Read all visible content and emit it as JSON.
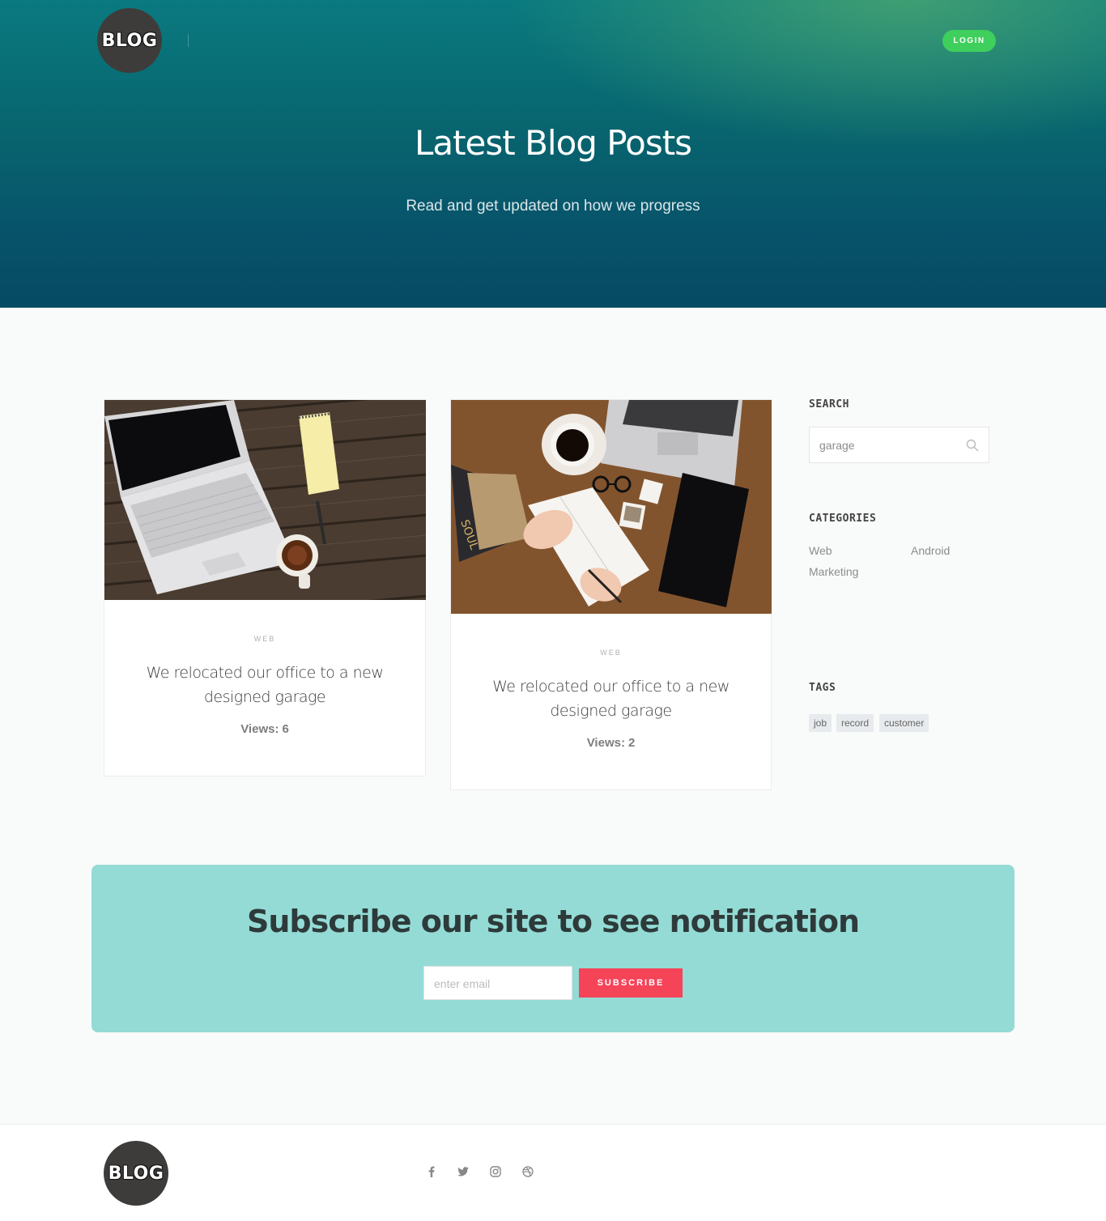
{
  "header": {
    "logo_text": "BLOG",
    "login_label": "LOGIN",
    "title": "Latest Blog Posts",
    "subtitle": "Read and get updated on how we progress"
  },
  "posts": [
    {
      "category": "WEB",
      "title": "We relocated our office to a new designed garage",
      "views_label": "Views:",
      "views": "6"
    },
    {
      "category": "WEB",
      "title": "We relocated our office to a new designed garage",
      "views_label": "Views:",
      "views": "2"
    }
  ],
  "sidebar": {
    "search_heading": "SEARCH",
    "search_value": "garage",
    "categories_heading": "CATEGORIES",
    "categories": [
      "Web",
      "Android",
      "Marketing"
    ],
    "tags_heading": "TAGS",
    "tags": [
      "job",
      "record",
      "customer"
    ]
  },
  "subscribe": {
    "title": "Subscribe our site to see notification",
    "email_placeholder": "enter email",
    "button_label": "SUBSCRIBE"
  },
  "footer": {
    "logo_text": "BLOG",
    "social": [
      "facebook-icon",
      "twitter-icon",
      "instagram-icon",
      "dribbble-icon"
    ]
  },
  "colors": {
    "login": "#3ecf5c",
    "subscribe_bg": "#94dbd6",
    "subscribe_button": "#f54358"
  }
}
